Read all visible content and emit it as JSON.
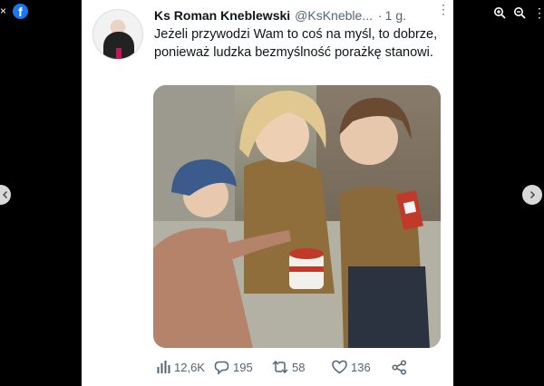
{
  "viewer": {
    "close_glyph": "×",
    "facebook_glyph": "f",
    "more_glyph": "⋮",
    "icons": [
      "close-icon",
      "facebook-logo",
      "zoom-in-icon",
      "zoom-out-icon",
      "more-icon",
      "arrow-left-icon",
      "arrow-right-icon"
    ]
  },
  "tweet": {
    "author_name": "Ks Roman Kneblewski",
    "handle": "@KsKneble...",
    "separator": "·",
    "time": "1 g.",
    "more_glyph": "⋮",
    "text": "Jeżeli przywodzi Wam to coś na myśl, to dobrze, ponieważ ludzka bezmyślność porażkę stanowi.",
    "stats": {
      "views": "12,6K",
      "replies": "195",
      "retweets": "58",
      "likes": "136"
    }
  },
  "colors": {
    "facebook_blue": "#1877f2",
    "text_primary": "#0f1419",
    "text_secondary": "#536471"
  }
}
